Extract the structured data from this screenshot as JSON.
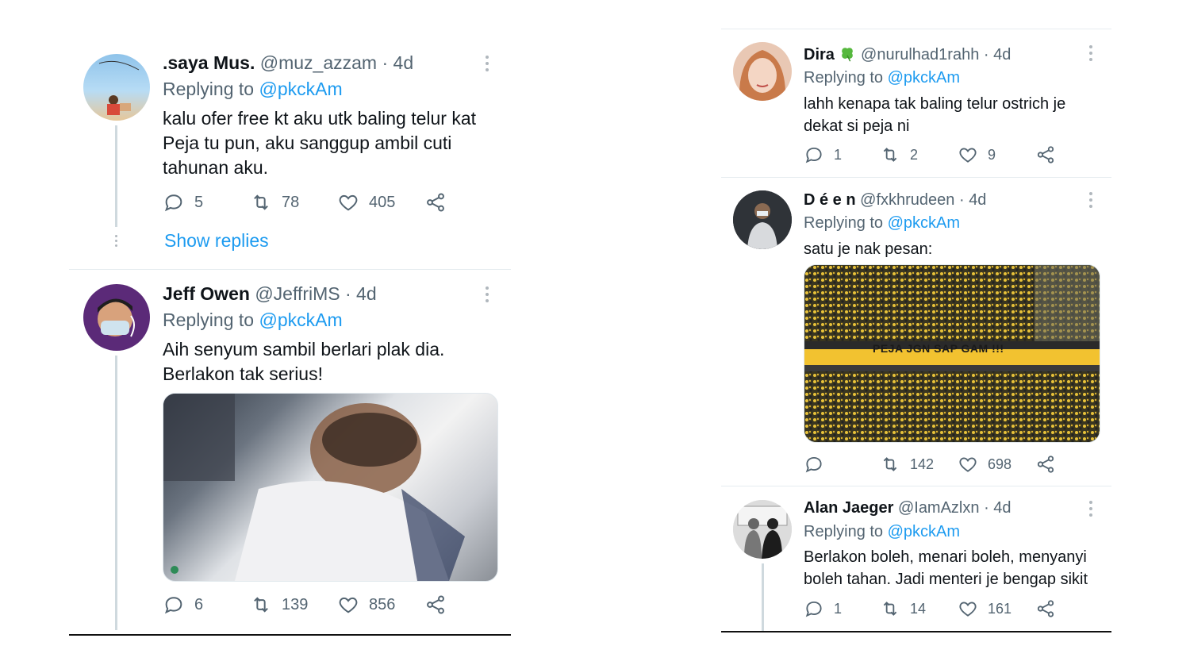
{
  "left_thread": {
    "tweet1": {
      "name": ".saya Mus.",
      "handle": "@muz_azzam",
      "time": "4d",
      "replying_label": "Replying to",
      "replying_to": "@pkckAm",
      "text": "kalu ofer free kt aku utk baling telur kat Peja tu pun, aku sanggup ambil cuti tahunan aku.",
      "replies": "5",
      "retweets": "78",
      "likes": "405",
      "show_replies": "Show replies"
    },
    "tweet2": {
      "name": "Jeff Owen",
      "handle": "@JeffriMS",
      "time": "4d",
      "replying_label": "Replying to",
      "replying_to": "@pkckAm",
      "text": "Aih senyum sambil berlari plak dia. Berlakon tak serius!",
      "replies": "6",
      "retweets": "139",
      "likes": "856"
    }
  },
  "right_thread": {
    "tweet1": {
      "name": "Dira",
      "name_emoji": "clover-icon",
      "handle": "@nurulhad1rahh",
      "time": "4d",
      "replying_label": "Replying to",
      "replying_to": "@pkckAm",
      "text": "lahh kenapa tak baling telur ostrich je dekat si peja ni",
      "replies": "1",
      "retweets": "2",
      "likes": "9"
    },
    "tweet2": {
      "name": "D é e n",
      "handle": "@fxkhrudeen",
      "time": "4d",
      "replying_label": "Replying to",
      "replying_to": "@pkckAm",
      "text": "satu je nak pesan:",
      "banner_text": "PEJA JGN SAP GAM !!!",
      "replies": "",
      "retweets": "142",
      "likes": "698"
    },
    "tweet3": {
      "name": "Alan Jaeger",
      "handle": "@IamAzlxn",
      "time": "4d",
      "replying_label": "Replying to",
      "replying_to": "@pkckAm",
      "text": "Berlakon boleh, menari boleh, menyanyi boleh tahan. Jadi menteri je bengap sikit",
      "replies": "1",
      "retweets": "14",
      "likes": "161"
    }
  },
  "colors": {
    "link": "#1d9bf0",
    "muted": "#536471",
    "text": "#0f1419",
    "banner_yellow": "#f2c230"
  }
}
